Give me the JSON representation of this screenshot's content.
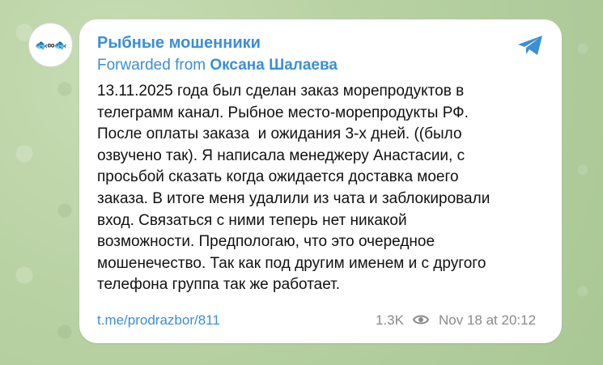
{
  "avatar": {
    "text": "🐟∞🐟"
  },
  "message": {
    "channel_name": "Рыбные мошенники",
    "forward_prefix": "Forwarded from",
    "forward_author": "Оксана Шалаева",
    "text": "13.11.2025 года был сделан заказ морепродуктов в\nтелеграмм канал. Рыбное место-морепродукты РФ.\nПосле оплаты заказа  и ожидания 3-х дней. ((было\nозвучено так). Я написала менеджеру Анастасии, с\nпросьбой сказать когда ожидается доставка моего\nзаказа. В итоге меня удалили из чата и заблокировали\nвход. Связаться с ними теперь нет никакой\nвозможности. Предпологаю, что это очередное\nмошенечество. Так как под другим именем и с другого\nтелефона группа так же работает.",
    "link": "t.me/prodrazbor/811",
    "views": "1.3K",
    "timestamp": "Nov 18 at 20:12"
  },
  "icons": {
    "share": "telegram-share-icon",
    "views": "eye-icon"
  },
  "colors": {
    "accent": "#3a8fd6",
    "meta": "#8a8a8a",
    "background": "#b9d2a4"
  }
}
